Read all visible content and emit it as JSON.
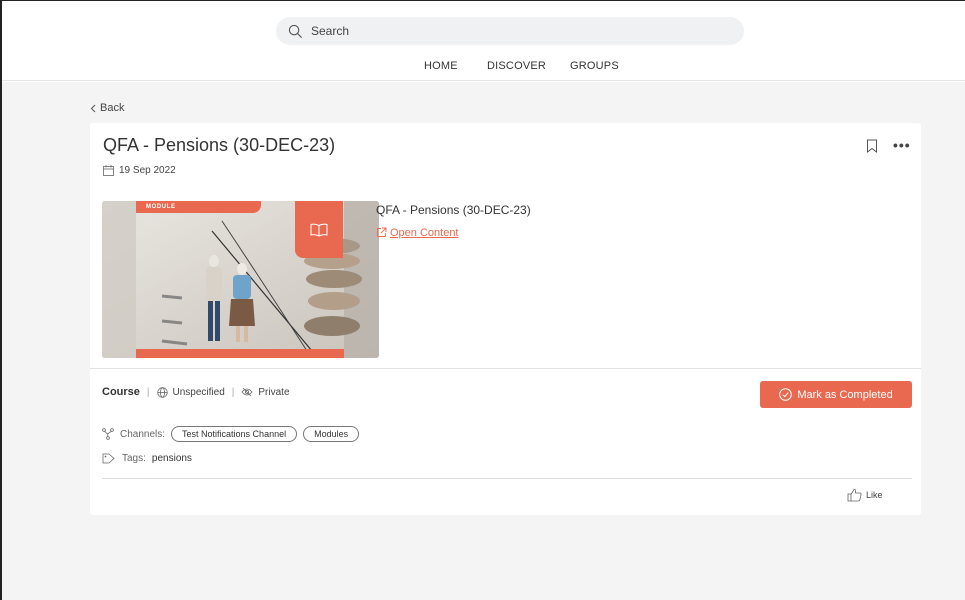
{
  "search": {
    "placeholder": "Search"
  },
  "nav": {
    "items": [
      {
        "label": "HOME"
      },
      {
        "label": "DISCOVER"
      },
      {
        "label": "GROUPS"
      }
    ]
  },
  "back_label": "Back",
  "item": {
    "title": "QFA - Pensions (30-DEC-23)",
    "date": "19 Sep 2022",
    "module_tag": "MODULE",
    "content_title": "QFA - Pensions (30-DEC-23)",
    "open_content_label": "Open Content",
    "type": "Course",
    "language": "Unspecified",
    "visibility": "Private",
    "mark_completed_label": "Mark as Completed",
    "channels_label": "Channels:",
    "channels": [
      "Test Notifications Channel",
      "Modules"
    ],
    "tags_label": "Tags:",
    "tags_value": "pensions",
    "like_label": "Like"
  },
  "colors": {
    "accent": "#e8694f",
    "background": "#f4f4f5",
    "search_bg": "#f0f1f3"
  },
  "icons": [
    "search-icon",
    "chevron-left-icon",
    "calendar-icon",
    "bookmark-icon",
    "more-icon",
    "book-icon",
    "external-link-icon",
    "globe-icon",
    "eye-off-icon",
    "check-circle-icon",
    "channels-icon",
    "tag-icon",
    "thumbs-up-icon"
  ]
}
